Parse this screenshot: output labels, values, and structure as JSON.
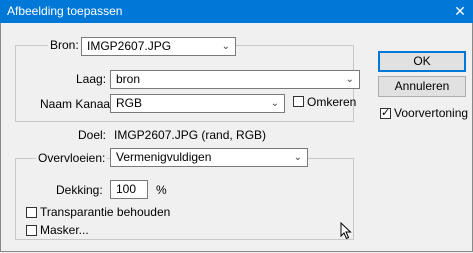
{
  "window": {
    "title": "Afbeelding toepassen",
    "close_glyph": "✕"
  },
  "source": {
    "bron_label": "Bron:",
    "bron_value": "IMGP2607.JPG",
    "laag_label": "Laag:",
    "laag_value": "bron",
    "kanaal_label": "Naam Kanaal:",
    "kanaal_value": "RGB",
    "omkeren_label": "Omkeren",
    "omkeren_checked": false
  },
  "target": {
    "doel_label": "Doel:",
    "doel_value": "IMGP2607.JPG (rand, RGB)"
  },
  "blending": {
    "overvloeien_label": "Overvloeien:",
    "overvloeien_value": "Vermenigvuldigen",
    "dekking_label": "Dekking:",
    "dekking_value": "100",
    "dekking_unit": "%",
    "transparantie_label": "Transparantie behouden",
    "transparantie_checked": false,
    "masker_label": "Masker...",
    "masker_checked": false
  },
  "buttons": {
    "ok_label": "OK",
    "cancel_label": "Annuleren",
    "preview_label": "Voorvertoning",
    "preview_checked": true
  },
  "colors": {
    "titlebar": "#0078d7",
    "background": "#f0f0f0",
    "focus": "#0078d7"
  }
}
